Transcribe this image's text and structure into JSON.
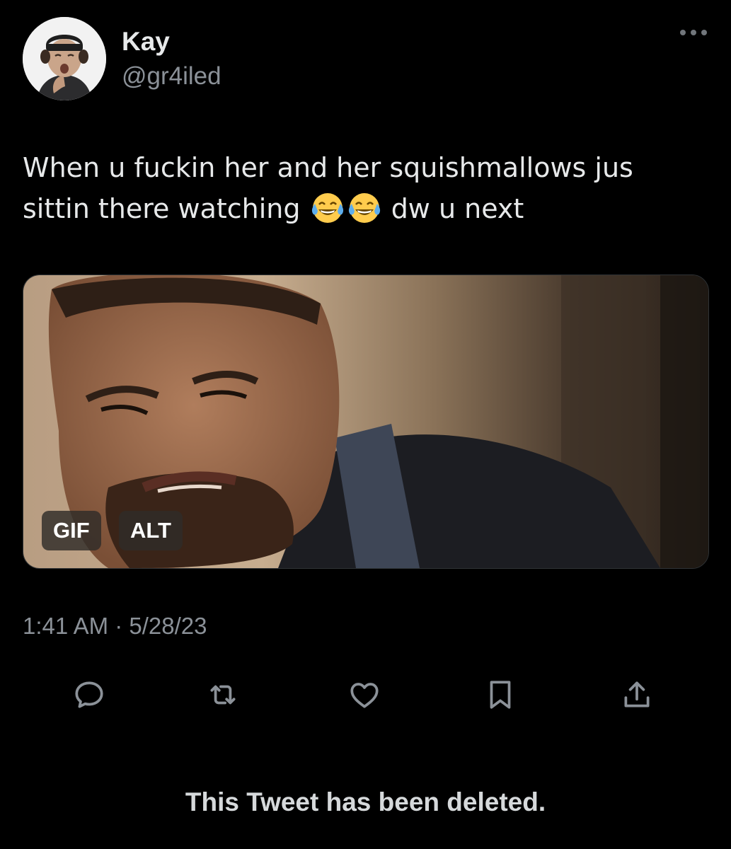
{
  "user": {
    "display_name": "Kay",
    "handle": "@gr4iled",
    "avatar_icon": "memoji-avatar"
  },
  "tweet": {
    "text_parts": [
      "When u fuckin her and her squishmallows jus sittin there watching",
      "dw u next"
    ],
    "emojis": [
      "face-with-tears-of-joy",
      "face-with-tears-of-joy"
    ],
    "timestamp": "1:41 AM · 5/28/23"
  },
  "media": {
    "type": "gif",
    "gif_badge": "GIF",
    "alt_badge": "ALT"
  },
  "actions": [
    {
      "name": "reply",
      "icon": "speech-bubble-icon"
    },
    {
      "name": "retweet",
      "icon": "retweet-arrows-icon"
    },
    {
      "name": "like",
      "icon": "heart-icon"
    },
    {
      "name": "bookmark",
      "icon": "bookmark-icon"
    },
    {
      "name": "share",
      "icon": "share-upload-icon"
    }
  ],
  "footer": {
    "deleted_notice": "This Tweet has been deleted."
  },
  "colors": {
    "background": "#000000",
    "primary_text": "#e7e9ea",
    "secondary_text": "#8b9198",
    "icon": "#8b9198"
  }
}
